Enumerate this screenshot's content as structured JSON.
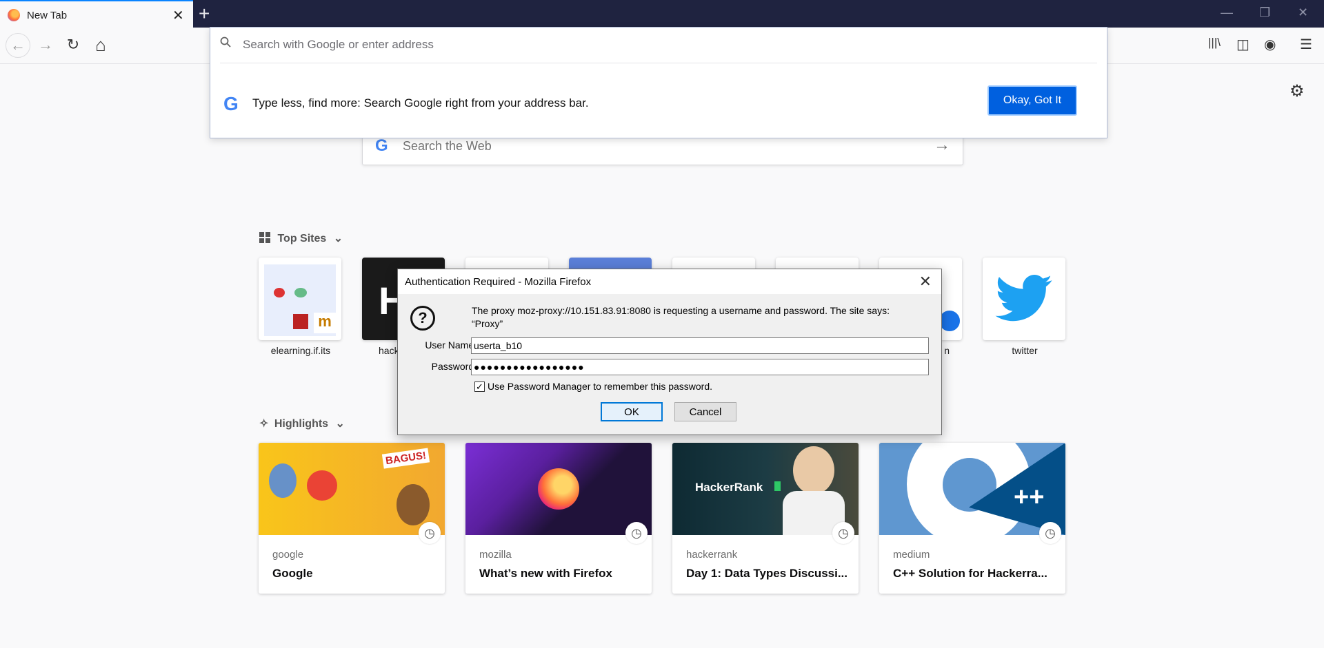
{
  "tab": {
    "title": "New Tab"
  },
  "urlbar": {
    "placeholder": "Search with Google or enter address",
    "tip_text": "Type less, find more: Search Google right from your address bar.",
    "tip_button": "Okay, Got It",
    "google_letter": "G"
  },
  "websearch": {
    "placeholder": "Search the Web",
    "google_letter": "G"
  },
  "top_sites": {
    "heading": "Top Sites",
    "items": [
      {
        "label": "elearning.if.its"
      },
      {
        "label": "hack"
      },
      {
        "label": ""
      },
      {
        "label": ""
      },
      {
        "label": ""
      },
      {
        "label": ""
      },
      {
        "label": "n"
      },
      {
        "label": "twitter"
      }
    ]
  },
  "highlights": {
    "heading": "Highlights",
    "cards": [
      {
        "host": "google",
        "title": "Google",
        "image_text": "BAGUS!"
      },
      {
        "host": "mozilla",
        "title": "What’s new with Firefox"
      },
      {
        "host": "hackerrank",
        "title": "Day 1: Data Types Discussi...",
        "image_text": "HackerRank"
      },
      {
        "host": "medium",
        "title": "C++ Solution for Hackerra...",
        "image_text": "++"
      }
    ]
  },
  "dialog": {
    "title": "Authentication Required - Mozilla Firefox",
    "message": "The proxy moz-proxy://10.151.83.91:8080 is requesting a username and password. The site says: “Proxy”",
    "username_label": "User Name:",
    "username_value": "userta_b10",
    "password_label": "Password:",
    "password_value": "●●●●●●●●●●●●●●●●●",
    "remember_label": "Use Password Manager to remember this password.",
    "remember_checked": true,
    "ok_label": "OK",
    "cancel_label": "Cancel"
  },
  "colors": {
    "accent": "#0a84ff",
    "button_primary": "#0060df",
    "titlebar": "#1f2340"
  },
  "icons": {
    "tab_close": "✕",
    "new_tab": "+",
    "back": "←",
    "forward": "→",
    "reload": "↻",
    "home": "⌂",
    "minimize": "—",
    "restore": "❐",
    "close": "✕",
    "library": "|||\\",
    "sidebar": "◫",
    "account": "◉",
    "menu": "☰",
    "gear": "⚙",
    "arrow": "→",
    "clock": "◷",
    "chevron": "⌄",
    "question": "?",
    "check": "✓"
  }
}
